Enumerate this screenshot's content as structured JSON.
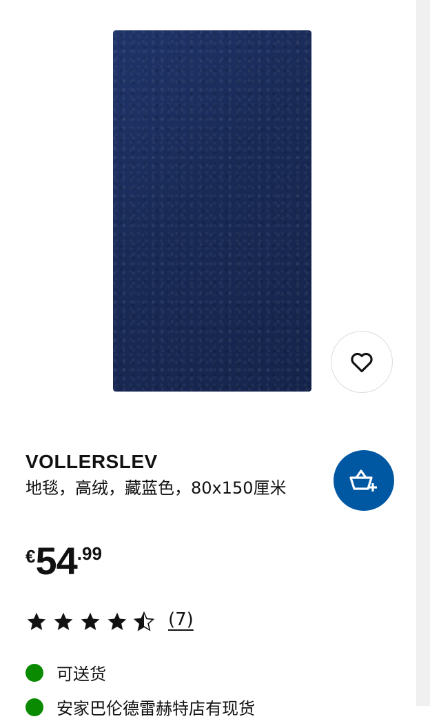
{
  "product": {
    "name": "VOLLERSLEV",
    "description": "地毯，高绒，藏蓝色，80x150厘米",
    "price": {
      "currency": "€",
      "integer": "54",
      "decimal": ".99"
    },
    "rating": {
      "value": 4.5,
      "max": 5,
      "review_count_label": "(7)"
    },
    "image_color": "#1b2c59"
  },
  "availability": [
    {
      "label": "可送货",
      "status_color": "#0a8a00"
    },
    {
      "label": "安家巴伦德雷赫特店有现货",
      "status_color": "#0a8a00"
    }
  ],
  "actions": {
    "favourite_icon": "heart-icon",
    "add_to_cart_icon": "basket-plus-icon",
    "cart_button_color": "#0058a3"
  }
}
